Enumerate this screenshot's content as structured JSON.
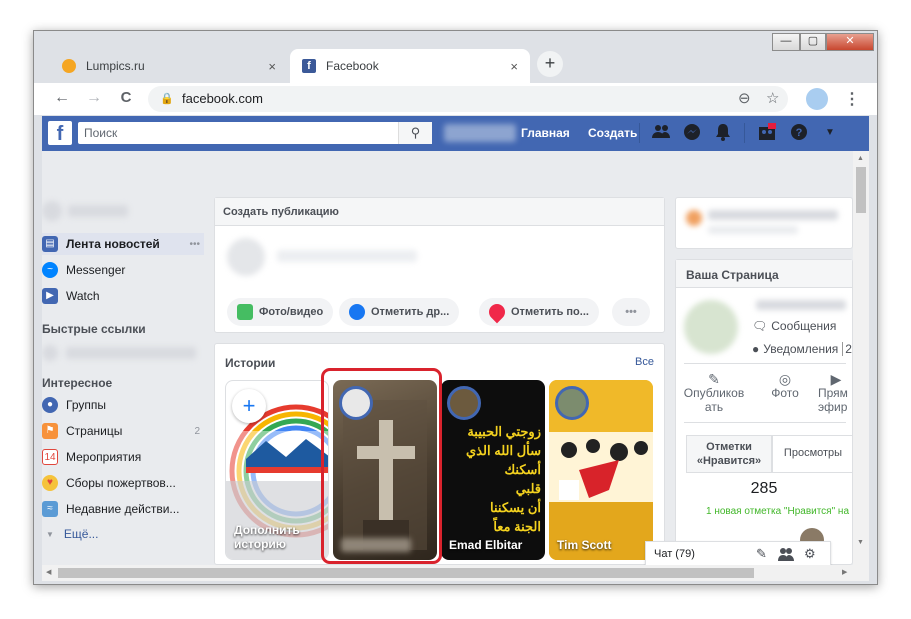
{
  "window": {
    "minimize": "—",
    "maximize": "▢",
    "close": "✕"
  },
  "tabs": [
    {
      "title": "Lumpics.ru",
      "close": "×"
    },
    {
      "title": "Facebook",
      "close": "×"
    }
  ],
  "new_tab": "+",
  "toolbar": {
    "back": "←",
    "forward": "→",
    "reload": "C",
    "url": "facebook.com",
    "zoom": "⊖",
    "star": "☆",
    "menu": "⋮"
  },
  "fb_header": {
    "logo": "f",
    "search_placeholder": "Поиск",
    "search_icon": "⚲",
    "home": "Главная",
    "create": "Создать"
  },
  "left_nav": {
    "news_feed": "Лента новостей",
    "news_feed_more": "•••",
    "messenger": "Messenger",
    "watch": "Watch",
    "shortcuts_header": "Быстрые ссылки",
    "interests_header": "Интересное",
    "items": [
      {
        "label": "Группы",
        "count": ""
      },
      {
        "label": "Страницы",
        "count": "2"
      },
      {
        "label": "Мероприятия",
        "count": ""
      },
      {
        "label": "Сборы пожертвов...",
        "count": ""
      },
      {
        "label": "Недавние действи...",
        "count": ""
      }
    ],
    "more": "Ещё..."
  },
  "composer": {
    "title": "Создать публикацию",
    "photo_video": "Фото/видео",
    "tag_friends": "Отметить др...",
    "check_in": "Отметить по...",
    "more": "•••"
  },
  "stories": {
    "title": "Истории",
    "see_all": "Все",
    "add_story_label": "Дополнить историю",
    "add_icon": "+",
    "items": [
      {
        "name": ""
      },
      {
        "name": "Emad Elbitar",
        "overlay": "زوجتي الحبيبة\nسأل الله الذي أسكنك\nقلبي\nأن يسكننا\nالجنة معاً"
      },
      {
        "name": "Tim Scott"
      }
    ]
  },
  "right": {
    "your_page": "Ваша Страница",
    "messages": "Сообщения",
    "notifications": "Уведомления",
    "notifications_count": "2",
    "publish": "Опубликов ать",
    "photo": "Фото",
    "live": "Прям эфир",
    "likes_tab": "Отметки «Нравится»",
    "views_tab": "Просмотры",
    "likes_count": "285",
    "new_like": "1 новая отметка \"Нравится\" на"
  },
  "chat": {
    "label": "Чат (79)"
  },
  "colors": {
    "fb_blue": "#4267b2",
    "highlight_red": "#d9232d"
  }
}
